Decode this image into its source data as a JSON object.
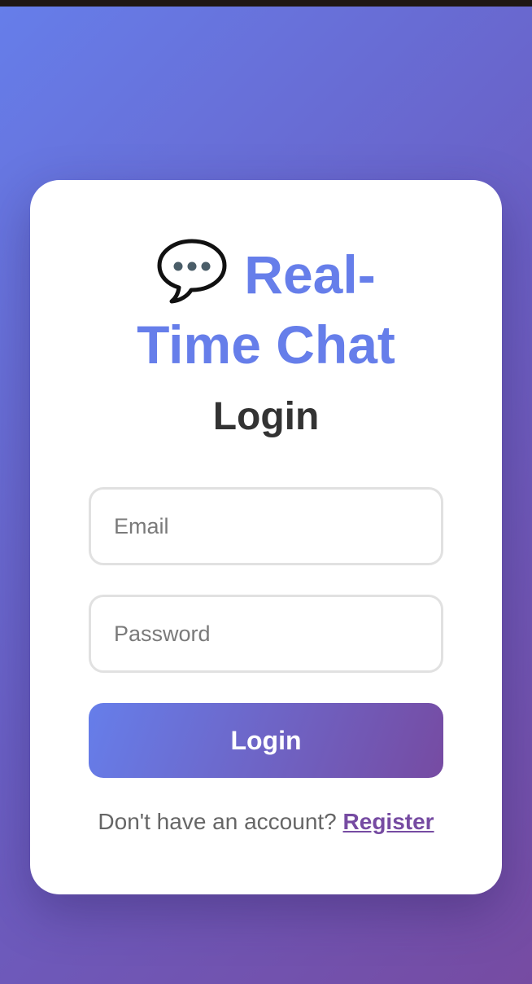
{
  "app": {
    "title_line1": "Real-",
    "title_line2": "Time Chat",
    "icon": "speech-bubble-icon"
  },
  "login_form": {
    "heading": "Login",
    "email_placeholder": "Email",
    "email_value": "",
    "password_placeholder": "Password",
    "password_value": "",
    "submit_label": "Login"
  },
  "footer": {
    "prompt_text": "Don't have an account?",
    "register_link": "Register"
  },
  "colors": {
    "accent": "#667eea",
    "accent_secondary": "#764ba2",
    "heading_text": "#333333",
    "muted_text": "#666666",
    "card_background": "#ffffff"
  }
}
